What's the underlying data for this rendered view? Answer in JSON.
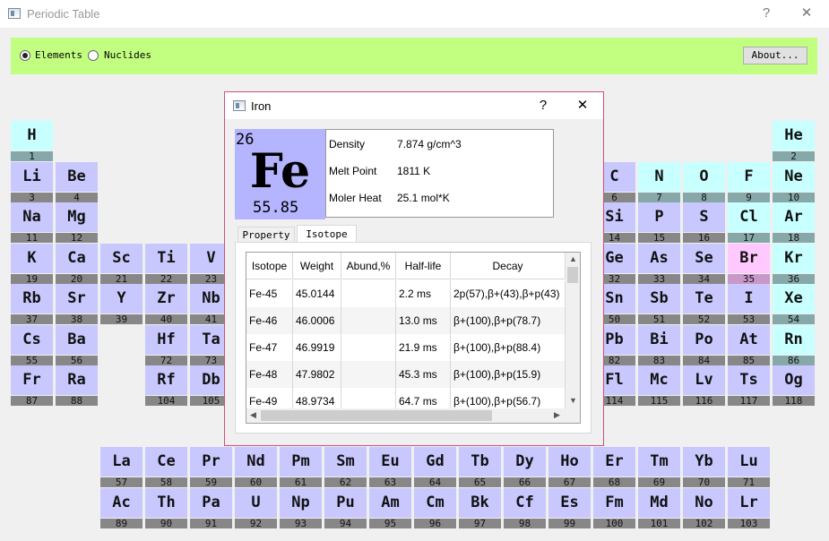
{
  "window": {
    "title": "Periodic Table",
    "help_glyph": "?",
    "close_glyph": "✕"
  },
  "mode": {
    "elements_label": "Elements",
    "nuclides_label": "Nuclides",
    "selected": "Elements"
  },
  "about_label": "About...",
  "colors": {
    "main_group": "#c8c8ff",
    "noble_gas": "#c8ffff",
    "halogen_br": "#ffc8ff",
    "label_bar": "#878787",
    "noble_label_bar": "#86a8a8",
    "br_label_bar": "#c898c8",
    "toolbar": "#c2ff80",
    "fe_tile": "#b4b4ff"
  },
  "elements": [
    {
      "s": "H",
      "n": "1",
      "r": 1,
      "c": 1,
      "k": "l"
    },
    {
      "s": "He",
      "n": "2",
      "r": 1,
      "c": 18,
      "k": "n"
    },
    {
      "s": "Li",
      "n": "3",
      "r": 2,
      "c": 1,
      "k": "m"
    },
    {
      "s": "Be",
      "n": "4",
      "r": 2,
      "c": 2,
      "k": "m"
    },
    {
      "s": "C",
      "n": "6",
      "r": 2,
      "c": 14,
      "k": "m"
    },
    {
      "s": "N",
      "n": "7",
      "r": 2,
      "c": 15,
      "k": "n"
    },
    {
      "s": "O",
      "n": "8",
      "r": 2,
      "c": 16,
      "k": "n"
    },
    {
      "s": "F",
      "n": "9",
      "r": 2,
      "c": 17,
      "k": "n"
    },
    {
      "s": "Ne",
      "n": "10",
      "r": 2,
      "c": 18,
      "k": "n"
    },
    {
      "s": "Na",
      "n": "11",
      "r": 3,
      "c": 1,
      "k": "m"
    },
    {
      "s": "Mg",
      "n": "12",
      "r": 3,
      "c": 2,
      "k": "m"
    },
    {
      "s": "Si",
      "n": "14",
      "r": 3,
      "c": 14,
      "k": "m"
    },
    {
      "s": "P",
      "n": "15",
      "r": 3,
      "c": 15,
      "k": "m"
    },
    {
      "s": "S",
      "n": "16",
      "r": 3,
      "c": 16,
      "k": "m"
    },
    {
      "s": "Cl",
      "n": "17",
      "r": 3,
      "c": 17,
      "k": "n"
    },
    {
      "s": "Ar",
      "n": "18",
      "r": 3,
      "c": 18,
      "k": "n"
    },
    {
      "s": "K",
      "n": "19",
      "r": 4,
      "c": 1,
      "k": "m"
    },
    {
      "s": "Ca",
      "n": "20",
      "r": 4,
      "c": 2,
      "k": "m"
    },
    {
      "s": "Sc",
      "n": "21",
      "r": 4,
      "c": 3,
      "k": "m"
    },
    {
      "s": "Ti",
      "n": "22",
      "r": 4,
      "c": 4,
      "k": "m"
    },
    {
      "s": "V",
      "n": "23",
      "r": 4,
      "c": 5,
      "k": "m"
    },
    {
      "s": "Ge",
      "n": "32",
      "r": 4,
      "c": 14,
      "k": "m"
    },
    {
      "s": "As",
      "n": "33",
      "r": 4,
      "c": 15,
      "k": "m"
    },
    {
      "s": "Se",
      "n": "34",
      "r": 4,
      "c": 16,
      "k": "m"
    },
    {
      "s": "Br",
      "n": "35",
      "r": 4,
      "c": 17,
      "k": "b"
    },
    {
      "s": "Kr",
      "n": "36",
      "r": 4,
      "c": 18,
      "k": "n"
    },
    {
      "s": "Rb",
      "n": "37",
      "r": 5,
      "c": 1,
      "k": "m"
    },
    {
      "s": "Sr",
      "n": "38",
      "r": 5,
      "c": 2,
      "k": "m"
    },
    {
      "s": "Y",
      "n": "39",
      "r": 5,
      "c": 3,
      "k": "m"
    },
    {
      "s": "Zr",
      "n": "40",
      "r": 5,
      "c": 4,
      "k": "m"
    },
    {
      "s": "Nb",
      "n": "41",
      "r": 5,
      "c": 5,
      "k": "m"
    },
    {
      "s": "Sn",
      "n": "50",
      "r": 5,
      "c": 14,
      "k": "m"
    },
    {
      "s": "Sb",
      "n": "51",
      "r": 5,
      "c": 15,
      "k": "m"
    },
    {
      "s": "Te",
      "n": "52",
      "r": 5,
      "c": 16,
      "k": "m"
    },
    {
      "s": "I",
      "n": "53",
      "r": 5,
      "c": 17,
      "k": "m"
    },
    {
      "s": "Xe",
      "n": "54",
      "r": 5,
      "c": 18,
      "k": "n"
    },
    {
      "s": "Cs",
      "n": "55",
      "r": 6,
      "c": 1,
      "k": "m"
    },
    {
      "s": "Ba",
      "n": "56",
      "r": 6,
      "c": 2,
      "k": "m"
    },
    {
      "s": "Hf",
      "n": "72",
      "r": 6,
      "c": 4,
      "k": "m"
    },
    {
      "s": "Ta",
      "n": "73",
      "r": 6,
      "c": 5,
      "k": "m"
    },
    {
      "s": "Pb",
      "n": "82",
      "r": 6,
      "c": 14,
      "k": "m"
    },
    {
      "s": "Bi",
      "n": "83",
      "r": 6,
      "c": 15,
      "k": "m"
    },
    {
      "s": "Po",
      "n": "84",
      "r": 6,
      "c": 16,
      "k": "m"
    },
    {
      "s": "At",
      "n": "85",
      "r": 6,
      "c": 17,
      "k": "m"
    },
    {
      "s": "Rn",
      "n": "86",
      "r": 6,
      "c": 18,
      "k": "n"
    },
    {
      "s": "Fr",
      "n": "87",
      "r": 7,
      "c": 1,
      "k": "m"
    },
    {
      "s": "Ra",
      "n": "88",
      "r": 7,
      "c": 2,
      "k": "m"
    },
    {
      "s": "Rf",
      "n": "104",
      "r": 7,
      "c": 4,
      "k": "m"
    },
    {
      "s": "Db",
      "n": "105",
      "r": 7,
      "c": 5,
      "k": "m"
    },
    {
      "s": "Fl",
      "n": "114",
      "r": 7,
      "c": 14,
      "k": "m"
    },
    {
      "s": "Mc",
      "n": "115",
      "r": 7,
      "c": 15,
      "k": "m"
    },
    {
      "s": "Lv",
      "n": "116",
      "r": 7,
      "c": 16,
      "k": "m"
    },
    {
      "s": "Ts",
      "n": "117",
      "r": 7,
      "c": 17,
      "k": "m"
    },
    {
      "s": "Og",
      "n": "118",
      "r": 7,
      "c": 18,
      "k": "m"
    },
    {
      "s": "La",
      "n": "57",
      "r": 9,
      "c": 3,
      "k": "m"
    },
    {
      "s": "Ce",
      "n": "58",
      "r": 9,
      "c": 4,
      "k": "m"
    },
    {
      "s": "Pr",
      "n": "59",
      "r": 9,
      "c": 5,
      "k": "m"
    },
    {
      "s": "Nd",
      "n": "60",
      "r": 9,
      "c": 6,
      "k": "m"
    },
    {
      "s": "Pm",
      "n": "61",
      "r": 9,
      "c": 7,
      "k": "m"
    },
    {
      "s": "Sm",
      "n": "62",
      "r": 9,
      "c": 8,
      "k": "m"
    },
    {
      "s": "Eu",
      "n": "63",
      "r": 9,
      "c": 9,
      "k": "m"
    },
    {
      "s": "Gd",
      "n": "64",
      "r": 9,
      "c": 10,
      "k": "m"
    },
    {
      "s": "Tb",
      "n": "65",
      "r": 9,
      "c": 11,
      "k": "m"
    },
    {
      "s": "Dy",
      "n": "66",
      "r": 9,
      "c": 12,
      "k": "m"
    },
    {
      "s": "Ho",
      "n": "67",
      "r": 9,
      "c": 13,
      "k": "m"
    },
    {
      "s": "Er",
      "n": "68",
      "r": 9,
      "c": 14,
      "k": "m"
    },
    {
      "s": "Tm",
      "n": "69",
      "r": 9,
      "c": 15,
      "k": "m"
    },
    {
      "s": "Yb",
      "n": "70",
      "r": 9,
      "c": 16,
      "k": "m"
    },
    {
      "s": "Lu",
      "n": "71",
      "r": 9,
      "c": 17,
      "k": "m"
    },
    {
      "s": "Ac",
      "n": "89",
      "r": 10,
      "c": 3,
      "k": "m"
    },
    {
      "s": "Th",
      "n": "90",
      "r": 10,
      "c": 4,
      "k": "m"
    },
    {
      "s": "Pa",
      "n": "91",
      "r": 10,
      "c": 5,
      "k": "m"
    },
    {
      "s": "U",
      "n": "92",
      "r": 10,
      "c": 6,
      "k": "m"
    },
    {
      "s": "Np",
      "n": "93",
      "r": 10,
      "c": 7,
      "k": "m"
    },
    {
      "s": "Pu",
      "n": "94",
      "r": 10,
      "c": 8,
      "k": "m"
    },
    {
      "s": "Am",
      "n": "95",
      "r": 10,
      "c": 9,
      "k": "m"
    },
    {
      "s": "Cm",
      "n": "96",
      "r": 10,
      "c": 10,
      "k": "m"
    },
    {
      "s": "Bk",
      "n": "97",
      "r": 10,
      "c": 11,
      "k": "m"
    },
    {
      "s": "Cf",
      "n": "98",
      "r": 10,
      "c": 12,
      "k": "m"
    },
    {
      "s": "Es",
      "n": "99",
      "r": 10,
      "c": 13,
      "k": "m"
    },
    {
      "s": "Fm",
      "n": "100",
      "r": 10,
      "c": 14,
      "k": "m"
    },
    {
      "s": "Md",
      "n": "101",
      "r": 10,
      "c": 15,
      "k": "m"
    },
    {
      "s": "No",
      "n": "102",
      "r": 10,
      "c": 16,
      "k": "m"
    },
    {
      "s": "Lr",
      "n": "103",
      "r": 10,
      "c": 17,
      "k": "m"
    }
  ],
  "dialog": {
    "title": "Iron",
    "help_glyph": "?",
    "close_glyph": "✕",
    "atomic_number": "26",
    "symbol": "Fe",
    "weight": "55.85",
    "props": [
      {
        "label": "Density",
        "value": "7.874 g/cm^3"
      },
      {
        "label": "Melt Point",
        "value": "1811 K"
      },
      {
        "label": "Moler Heat",
        "value": "25.1 mol*K"
      }
    ],
    "tabs": [
      "Property",
      "Isotope"
    ],
    "active_tab": "Isotope",
    "table": {
      "headers": [
        "Isotope",
        "Weight",
        "Abund,%",
        "Half-life",
        "Decay"
      ],
      "rows": [
        [
          "Fe-45",
          "45.0144",
          "",
          "2.2 ms",
          "2p(57),β+(43),β+p(43)"
        ],
        [
          "Fe-46",
          "46.0006",
          "",
          "13.0 ms",
          "β+(100),β+p(78.7)"
        ],
        [
          "Fe-47",
          "46.9919",
          "",
          "21.9 ms",
          "β+(100),β+p(88.4)"
        ],
        [
          "Fe-48",
          "47.9802",
          "",
          "45.3 ms",
          "β+(100),β+p(15.9)"
        ],
        [
          "Fe-49",
          "48.9734",
          "",
          "64.7 ms",
          "β+(100),β+p(56.7)"
        ]
      ]
    }
  }
}
